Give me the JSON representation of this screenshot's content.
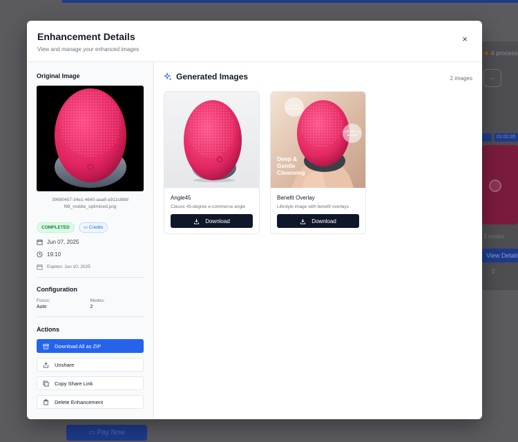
{
  "background": {
    "rating_text": "4 process",
    "view_details_label": "View Details",
    "pay_now_label": "Pay Now",
    "modes_label": "2 modes",
    "tag_label": "01:01:05"
  },
  "modal": {
    "title": "Enhancement Details",
    "subtitle": "View and manage your enhanced images",
    "close_label": "×"
  },
  "sidebar": {
    "original_title": "Original Image",
    "filename": "39680457-34e1-4640-aaa8-a911c88bf f98_mobile_optimized.png",
    "status_badge": "COMPLETED",
    "credits_badge": "Credits",
    "date": "Jun 07, 2025",
    "time": "19:10",
    "expires": "Expires: Jun 10, 2025",
    "config_title": "Configuration",
    "focus_label": "Focus:",
    "focus_value": "Auto",
    "modes_label": "Modes:",
    "modes_value": "2",
    "actions_title": "Actions",
    "actions": {
      "download_zip": "Download All as ZIP",
      "unshare": "Unshare",
      "copy_link": "Copy Share Link",
      "delete": "Delete Enhancement"
    }
  },
  "generated": {
    "title": "Generated Images",
    "count": "2 images",
    "items": [
      {
        "name": "Angle45",
        "description": "Classic 45-degree e-commerce angle",
        "button": "Download"
      },
      {
        "name": "Benefit Overlay",
        "description": "Lifestyle image with benefit overlays",
        "button": "Download",
        "overlay_text": "Deep & Gentle Cleansing",
        "bubble1": "T-Sonic Pulsations",
        "bubble2": "Soft Silicone Bristles"
      }
    ]
  },
  "colors": {
    "primary": "#2563eb",
    "dark_button": "#0f172a",
    "product_pink": "#e8336a",
    "completed_green": "#15803d"
  }
}
